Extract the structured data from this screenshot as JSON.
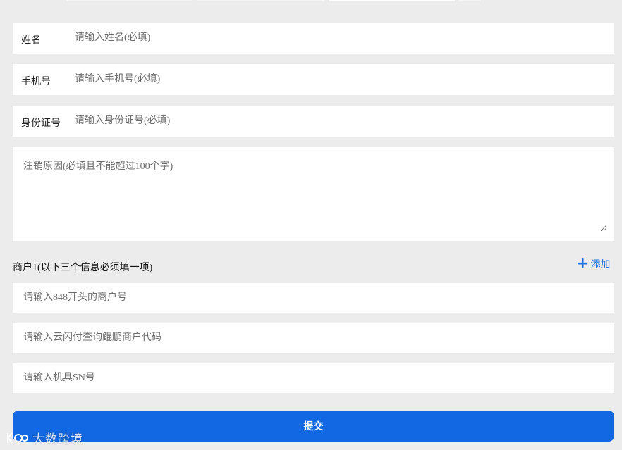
{
  "form": {
    "name": {
      "label": "姓名",
      "placeholder": "请输入姓名(必填)"
    },
    "phone": {
      "label": "手机号",
      "placeholder": "请输入手机号(必填)"
    },
    "id_card": {
      "label": "身份证号",
      "placeholder": "请输入身份证号(必填)"
    },
    "reason": {
      "placeholder": "注销原因(必填且不能超过100个字)"
    }
  },
  "merchant": {
    "title": "商户1(以下三个信息必须填一项)",
    "add_label": "添加",
    "merchant_no_placeholder": "请输入848开头的商户号",
    "cloud_code_placeholder": "请输入云闪付查询鲲鹏商户代码",
    "sn_placeholder": "请输入机具SN号"
  },
  "submit_label": "提交",
  "watermark": "大数跨境",
  "colors": {
    "accent": "#1268e3",
    "link": "#1f6fe0",
    "background": "#ececec"
  }
}
